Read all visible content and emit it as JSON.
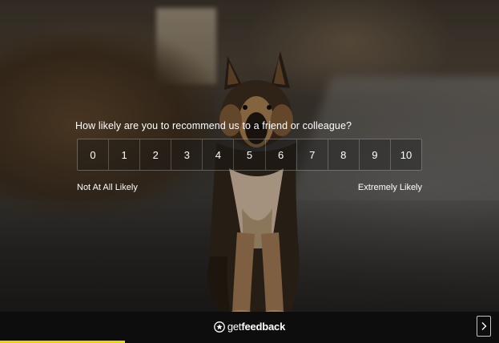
{
  "survey": {
    "question": "How likely are you to recommend us to a friend or colleague?",
    "scale": [
      "0",
      "1",
      "2",
      "3",
      "4",
      "5",
      "6",
      "7",
      "8",
      "9",
      "10"
    ],
    "low_label": "Not At All Likely",
    "high_label": "Extremely Likely"
  },
  "footer": {
    "brand_light": "get",
    "brand_bold": "feedback",
    "brand_icon": "star-circle-icon",
    "next_icon": "chevron-right-icon",
    "progress_fraction": 0.25
  },
  "colors": {
    "accent": "#f2d400",
    "footer_bg": "#0d0d0d",
    "text": "#ffffff"
  }
}
